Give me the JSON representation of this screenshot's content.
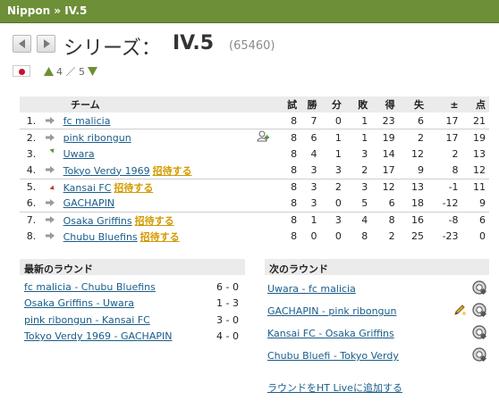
{
  "header": {
    "title": "Nippon » IV.5"
  },
  "series": {
    "label": "シリーズ：",
    "name": "IV.5",
    "id": "(65460)"
  },
  "level_nav": {
    "text": "4 ／ 5"
  },
  "table": {
    "columns": [
      "チーム",
      "試",
      "勝",
      "分",
      "敗",
      "得",
      "失",
      "±",
      "点"
    ],
    "rows": [
      {
        "pos": "1.",
        "arrow": "right",
        "team": "fc malicia",
        "invite": "",
        "icon": "",
        "p": "8",
        "w": "7",
        "d": "0",
        "l": "1",
        "gf": "23",
        "ga": "6",
        "gd": "17",
        "pts": "21"
      },
      {
        "pos": "2.",
        "arrow": "right",
        "team": "pink ribongun",
        "invite": "",
        "icon": "user-plus",
        "p": "8",
        "w": "6",
        "d": "1",
        "l": "1",
        "gf": "19",
        "ga": "2",
        "gd": "17",
        "pts": "19"
      },
      {
        "pos": "3.",
        "arrow": "up",
        "team": "Uwara",
        "invite": "",
        "icon": "",
        "p": "8",
        "w": "4",
        "d": "1",
        "l": "3",
        "gf": "14",
        "ga": "12",
        "gd": "2",
        "pts": "13"
      },
      {
        "pos": "4.",
        "arrow": "right",
        "team": "Tokyo Verdy 1969",
        "invite": "招待する",
        "icon": "",
        "p": "8",
        "w": "3",
        "d": "3",
        "l": "2",
        "gf": "17",
        "ga": "9",
        "gd": "8",
        "pts": "12"
      },
      {
        "pos": "5.",
        "arrow": "down",
        "team": "Kansai FC",
        "invite": "招待する",
        "icon": "",
        "p": "8",
        "w": "3",
        "d": "2",
        "l": "3",
        "gf": "12",
        "ga": "13",
        "gd": "-1",
        "pts": "11"
      },
      {
        "pos": "6.",
        "arrow": "right",
        "team": "GACHAPIN",
        "invite": "",
        "icon": "",
        "p": "8",
        "w": "3",
        "d": "0",
        "l": "5",
        "gf": "6",
        "ga": "18",
        "gd": "-12",
        "pts": "9"
      },
      {
        "pos": "7.",
        "arrow": "right",
        "team": "Osaka Griffins",
        "invite": "招待する",
        "icon": "",
        "p": "8",
        "w": "1",
        "d": "3",
        "l": "4",
        "gf": "8",
        "ga": "16",
        "gd": "-8",
        "pts": "6"
      },
      {
        "pos": "8.",
        "arrow": "right",
        "team": "Chubu Bluefins",
        "invite": "招待する",
        "icon": "",
        "p": "8",
        "w": "0",
        "d": "0",
        "l": "8",
        "gf": "2",
        "ga": "25",
        "gd": "-23",
        "pts": "0"
      }
    ]
  },
  "latest_round": {
    "title": "最新のラウンド",
    "matches": [
      {
        "match": "fc malicia - Chubu Bluefins",
        "score": "6 - 0"
      },
      {
        "match": "Osaka Griffins - Uwara",
        "score": "1 - 3"
      },
      {
        "match": "pink ribongun - Kansai FC",
        "score": "3 - 0"
      },
      {
        "match": "Tokyo Verdy 1969 - GACHAPIN",
        "score": "4 - 0"
      }
    ]
  },
  "next_round": {
    "title": "次のラウンド",
    "matches": [
      {
        "match": "Uwara - fc malicia",
        "edit": false
      },
      {
        "match": "GACHAPIN - pink ribongun",
        "edit": true
      },
      {
        "match": "Kansai FC - Osaka Griffins",
        "edit": false
      },
      {
        "match": "Chubu Bluefi - Tokyo Verdy",
        "edit": false
      }
    ],
    "add_live": "ラウンドをHT Liveに追加する"
  },
  "colors": {
    "header": "#6d8f37",
    "link": "#1a5d8a",
    "invite": "#d39b00"
  }
}
